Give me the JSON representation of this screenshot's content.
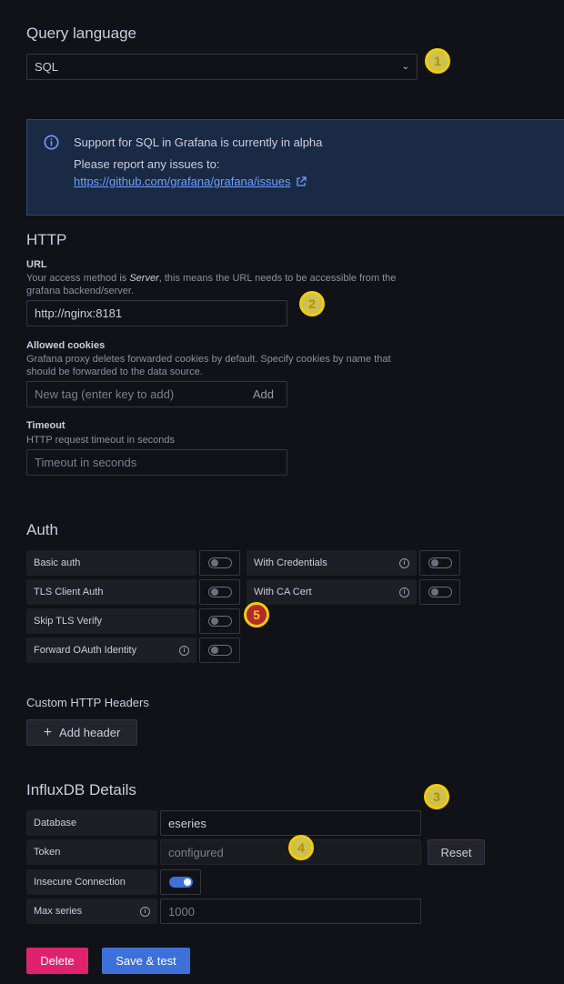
{
  "query_language": {
    "heading": "Query language",
    "selected": "SQL"
  },
  "alert": {
    "title": "Support for SQL in Grafana is currently in alpha",
    "body": "Please report any issues to:",
    "link": "https://github.com/grafana/grafana/issues"
  },
  "http": {
    "heading": "HTTP",
    "url_label": "URL",
    "url_desc_pre": "Your access method is ",
    "url_desc_em": "Server",
    "url_desc_post": ", this means the URL needs to be accessible from the grafana backend/server.",
    "url_value": "http://nginx:8181",
    "cookies_label": "Allowed cookies",
    "cookies_desc": "Grafana proxy deletes forwarded cookies by default. Specify cookies by name that should be forwarded to the data source.",
    "cookies_placeholder": "New tag (enter key to add)",
    "cookies_add": "Add",
    "timeout_label": "Timeout",
    "timeout_desc": "HTTP request timeout in seconds",
    "timeout_placeholder": "Timeout in seconds"
  },
  "auth": {
    "heading": "Auth",
    "basic_auth": "Basic auth",
    "with_credentials": "With Credentials",
    "tls_client_auth": "TLS Client Auth",
    "with_ca_cert": "With CA Cert",
    "skip_tls_verify": "Skip TLS Verify",
    "forward_oauth": "Forward OAuth Identity"
  },
  "headers": {
    "heading": "Custom HTTP Headers",
    "add_label": "Add header"
  },
  "influx": {
    "heading": "InfluxDB Details",
    "database_label": "Database",
    "database_value": "eseries",
    "token_label": "Token",
    "token_value": "configured",
    "token_reset": "Reset",
    "insecure_label": "Insecure Connection",
    "insecure_on": true,
    "max_series_label": "Max series",
    "max_series_placeholder": "1000"
  },
  "actions": {
    "delete": "Delete",
    "save": "Save & test"
  },
  "badges": {
    "b1": "1",
    "b2": "2",
    "b3": "3",
    "b4": "4",
    "b5": "5"
  },
  "colors": {
    "accent": "#3d71d9",
    "danger": "#e0226e",
    "badge": "#f2cc0c"
  }
}
